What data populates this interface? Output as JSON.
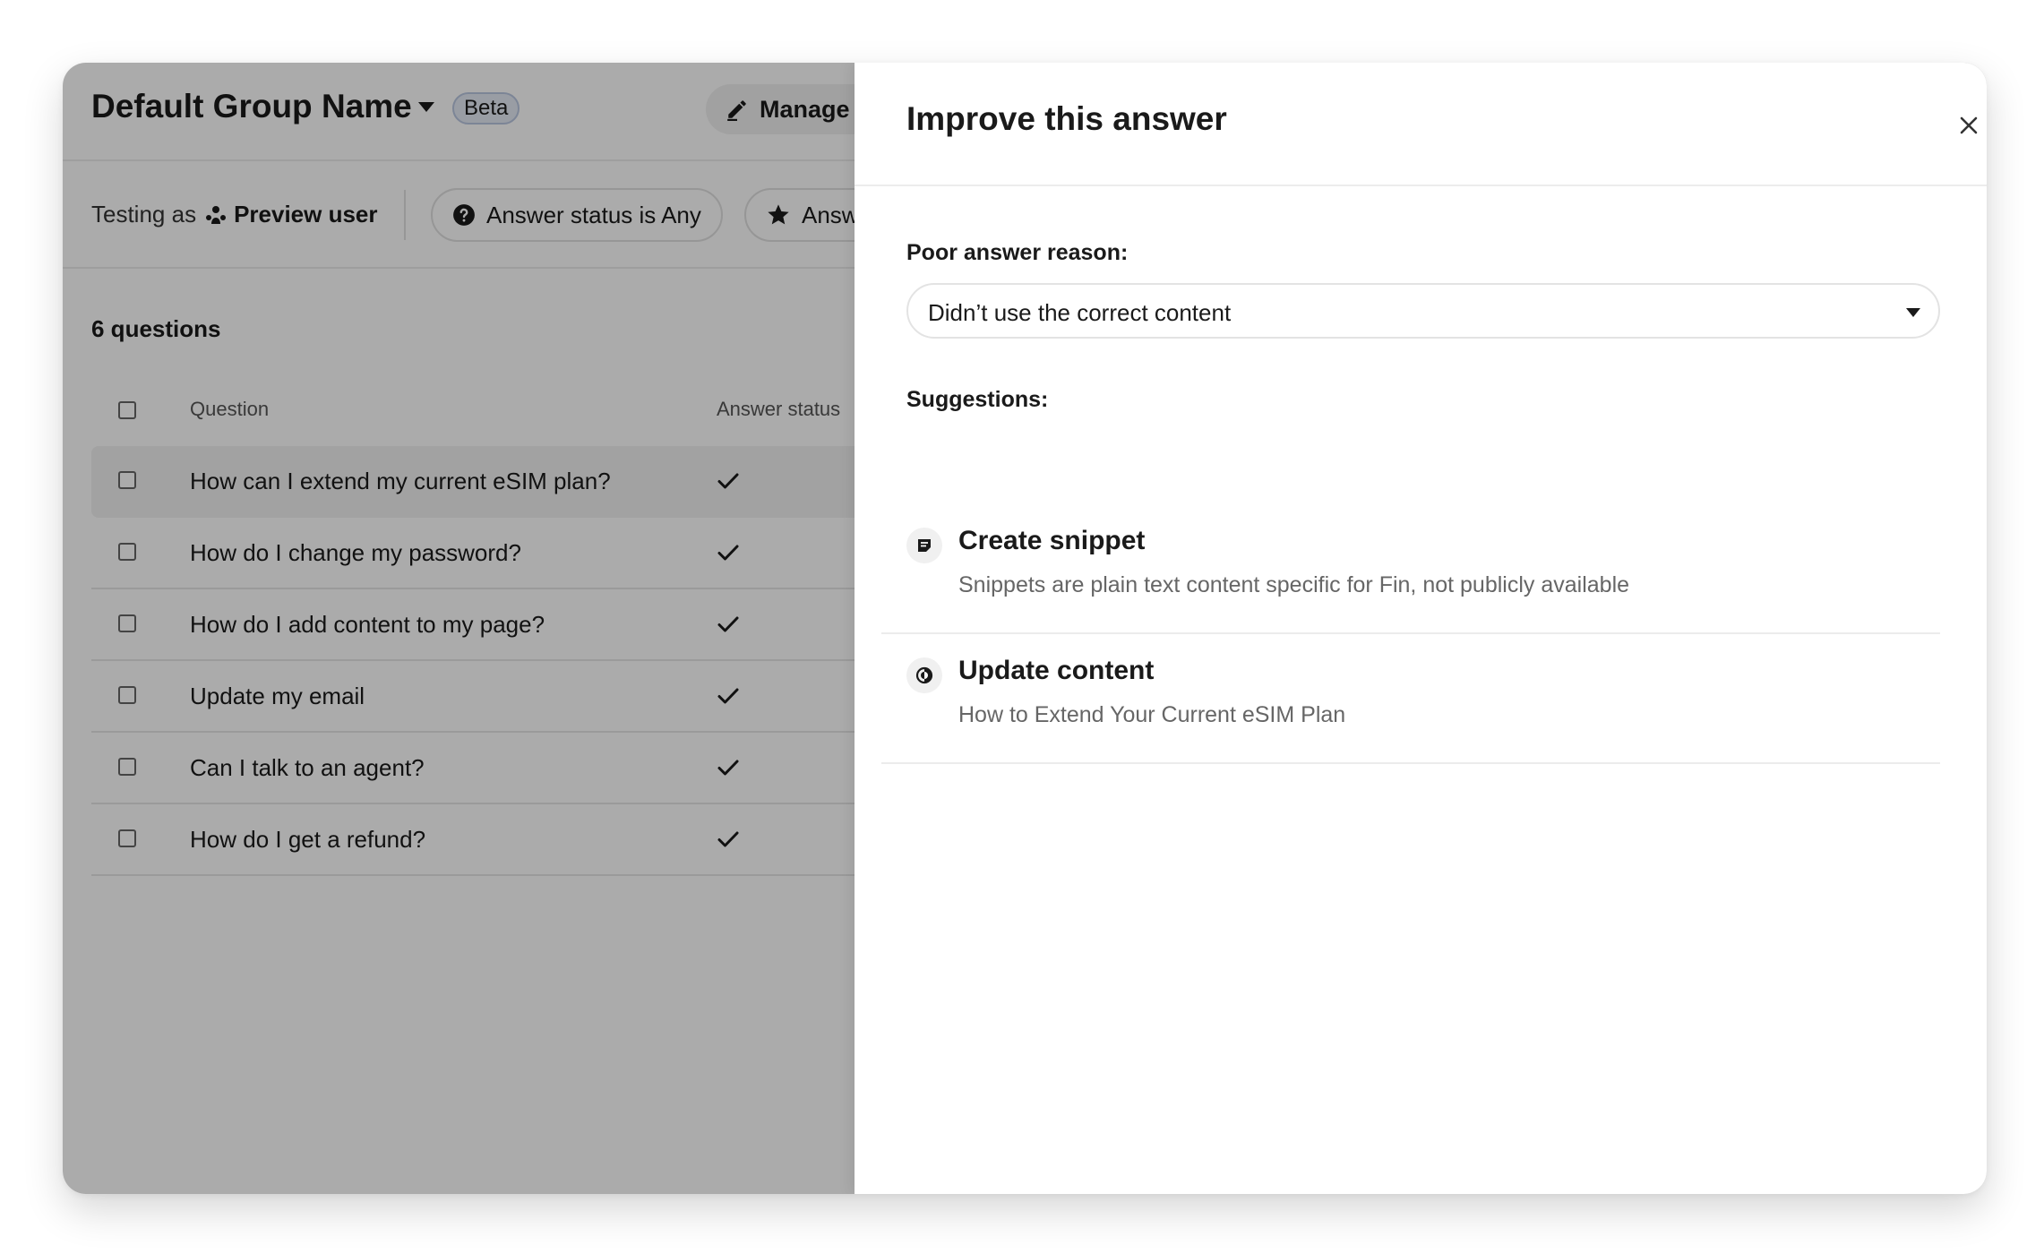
{
  "header": {
    "group_name": "Default Group Name",
    "badge": "Beta",
    "manage_label": "Manage"
  },
  "filters": {
    "testing_prefix": "Testing as",
    "testing_user": "Preview user",
    "answer_status_filter": "Answer status is Any",
    "second_filter_visible": "Answ"
  },
  "list": {
    "count": "6 questions",
    "col_question": "Question",
    "col_answer_status": "Answer status",
    "rows": [
      "How can I extend my current eSIM plan?",
      "How do I change my password?",
      "How do I add content to my page?",
      "Update my email",
      "Can I talk to an agent?",
      "How do I get a refund?"
    ]
  },
  "panel": {
    "title": "Improve this answer",
    "reason_label": "Poor answer reason:",
    "reason_value": "Didn’t use the correct content",
    "suggestions_label": "Suggestions:",
    "suggestions": [
      {
        "title": "Create snippet",
        "desc": "Snippets are plain text content specific for Fin, not publicly available",
        "icon": "snippet-icon"
      },
      {
        "title": "Update content",
        "desc": "How to Extend Your Current eSIM Plan",
        "icon": "content-icon"
      }
    ]
  }
}
